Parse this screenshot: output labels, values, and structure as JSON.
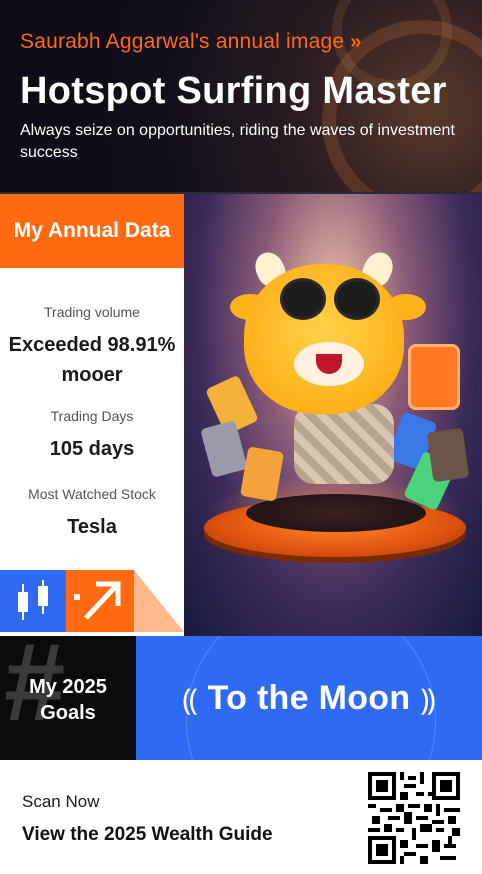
{
  "header": {
    "user_link": "Saurabh Aggarwal's annual image",
    "title": "Hotspot Surfing Master",
    "subtitle": "Always seize on opportunities, riding the waves of investment success"
  },
  "annual_data": {
    "tab_label": "My Annual Data",
    "stats": [
      {
        "label": "Trading volume",
        "value": "Exceeded 98.91% mooer"
      },
      {
        "label": "Trading Days",
        "value": "105 days"
      },
      {
        "label": "Most Watched Stock",
        "value": "Tesla"
      }
    ]
  },
  "goals": {
    "label": "My 2025 Goals",
    "motto": "To the Moon"
  },
  "footer": {
    "scan_label": "Scan Now",
    "guide_label": "View the 2025 Wealth Guide"
  },
  "colors": {
    "accent_orange": "#ff6a13",
    "accent_blue": "#2f6bf2"
  },
  "icons": [
    "candlestick-chart-icon",
    "growth-arrow-icon",
    "laurel-left-icon",
    "laurel-right-icon",
    "qr-code"
  ]
}
